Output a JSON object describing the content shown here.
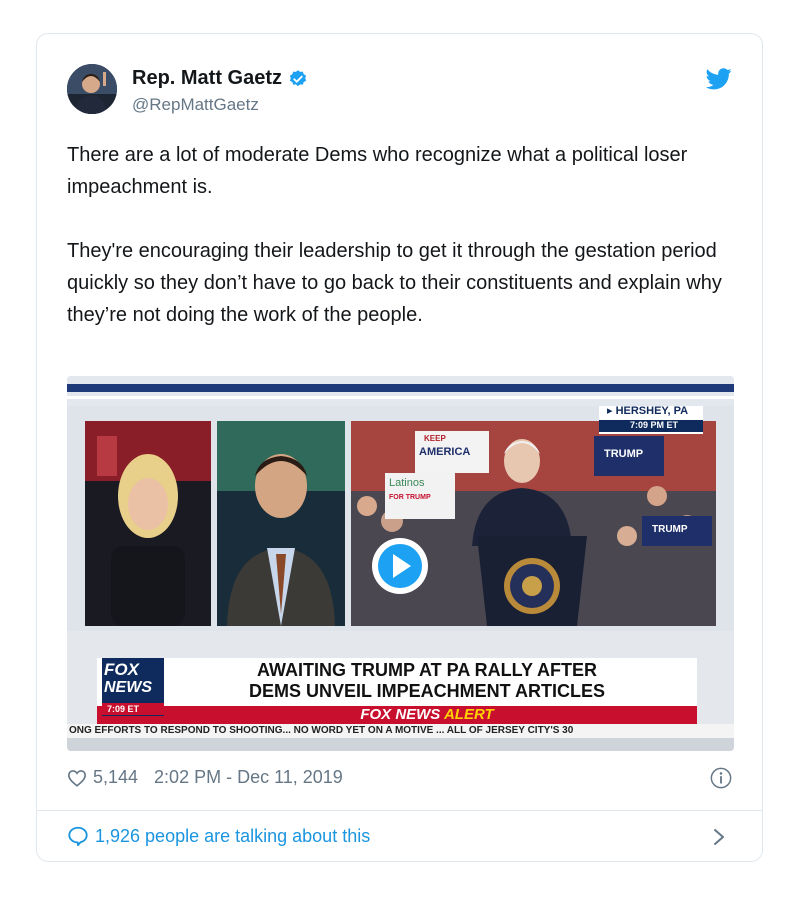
{
  "tweet": {
    "author_name": "Rep. Matt Gaetz",
    "handle": "@RepMattGaetz",
    "paragraphs": [
      "There are a lot of moderate Dems who recognize what a political loser impeachment is.",
      "They're encouraging their leadership to get it through the gestation period quickly so they don’t have to go back to their constituents and explain why they’re not doing the work of the people."
    ],
    "likes": "5,144",
    "timestamp": "2:02 PM - Dec 11, 2019",
    "talking": "1,926 people are talking about this"
  },
  "video": {
    "location": "▸ HERSHEY, PA",
    "location_time": "7:09 PM ET",
    "headline_1": "AWAITING TRUMP AT PA RALLY AFTER",
    "headline_2": "DEMS UNVEIL IMPEACHMENT ARTICLES",
    "alert_prefix": "FOX NEWS",
    "alert_word": "ALERT",
    "logo_1": "FOX",
    "logo_2": "NEWS",
    "logo_time": "7:09 ET",
    "ticker": "ONG EFFORTS TO RESPOND TO SHOOTING...  NO WORD YET ON A MOTIVE ...  ALL OF JERSEY CITY'S 30",
    "sign_keep": "KEEP",
    "sign_america": "AMERICA",
    "sign_latinos": "Latinos",
    "sign_for_trump": "FOR TRUMP",
    "sign_trump": "TRUMP"
  },
  "colors": {
    "twitter_blue": "#1da1f2",
    "link_blue": "#1b95e0",
    "fox_red": "#c8102e",
    "fox_navy": "#0f2a5c"
  },
  "icons": [
    "verified-icon",
    "twitter-bird-icon",
    "play-icon",
    "heart-icon",
    "info-icon",
    "comment-bubble-icon",
    "chevron-right-icon"
  ]
}
